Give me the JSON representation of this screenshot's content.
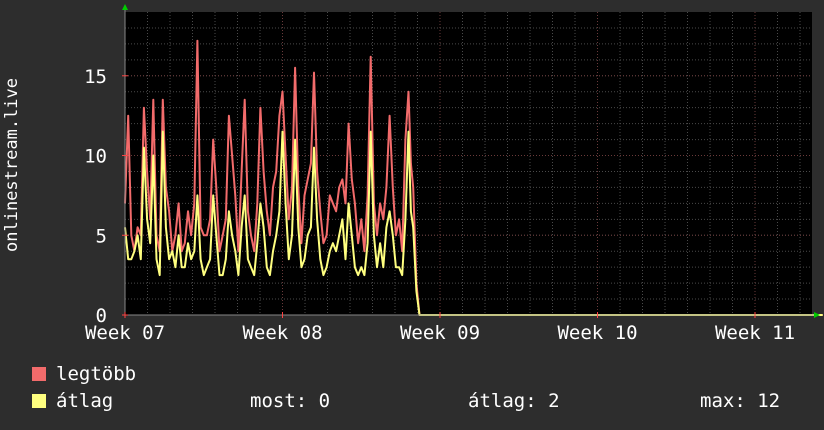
{
  "chart_data": {
    "type": "line",
    "ylabel": "onlinestream.live",
    "x_tick_labels": [
      "Week 07",
      "Week 08",
      "Week 09",
      "Week 10",
      "Week 11"
    ],
    "y_ticks": [
      0,
      5,
      10,
      15
    ],
    "ylim": [
      0,
      19
    ],
    "xlim": [
      0,
      4.435
    ],
    "grid": true,
    "background_color": "#000000",
    "grid_color": "#4a4a4a",
    "tick_color": "#ff4444",
    "axis_color": "#888888",
    "series": [
      {
        "name": "legtöbb",
        "color": "#f26b6b",
        "x": [
          0.0,
          0.02,
          0.04,
          0.06,
          0.08,
          0.1,
          0.12,
          0.14,
          0.16,
          0.18,
          0.2,
          0.22,
          0.24,
          0.26,
          0.28,
          0.3,
          0.32,
          0.34,
          0.36,
          0.38,
          0.4,
          0.42,
          0.44,
          0.46,
          0.48,
          0.5,
          0.52,
          0.54,
          0.56,
          0.58,
          0.6,
          0.62,
          0.64,
          0.66,
          0.68,
          0.7,
          0.72,
          0.74,
          0.76,
          0.78,
          0.8,
          0.82,
          0.84,
          0.86,
          0.88,
          0.9,
          0.92,
          0.94,
          0.96,
          0.98,
          1.0,
          1.02,
          1.04,
          1.06,
          1.08,
          1.1,
          1.12,
          1.14,
          1.16,
          1.18,
          1.2,
          1.22,
          1.24,
          1.26,
          1.28,
          1.3,
          1.32,
          1.34,
          1.36,
          1.38,
          1.4,
          1.42,
          1.44,
          1.46,
          1.48,
          1.5,
          1.52,
          1.54,
          1.56,
          1.58,
          1.6,
          1.62,
          1.64,
          1.66,
          1.68,
          1.7,
          1.72,
          1.74,
          1.76,
          1.78,
          1.8,
          1.815,
          1.83,
          1.85,
          1.87,
          4.43
        ],
        "y": [
          7.0,
          12.5,
          5.0,
          4.0,
          5.5,
          5.0,
          13.0,
          9.0,
          6.0,
          13.5,
          5.0,
          4.0,
          13.5,
          8.0,
          6.5,
          4.0,
          5.0,
          7.0,
          4.0,
          4.5,
          6.5,
          5.0,
          7.0,
          17.2,
          5.5,
          5.0,
          5.0,
          6.0,
          11.0,
          8.0,
          4.0,
          5.0,
          6.0,
          12.5,
          10.0,
          7.5,
          4.0,
          9.0,
          13.5,
          6.5,
          5.0,
          4.0,
          7.0,
          13.0,
          9.0,
          6.5,
          5.0,
          8.0,
          9.0,
          12.5,
          14.0,
          10.0,
          6.0,
          8.0,
          15.5,
          8.0,
          4.5,
          7.5,
          8.5,
          9.5,
          15.2,
          9.0,
          6.5,
          4.5,
          5.0,
          7.5,
          7.0,
          6.5,
          8.0,
          8.5,
          7.0,
          12.0,
          8.5,
          7.0,
          4.5,
          6.0,
          4.0,
          7.5,
          16.2,
          7.0,
          5.0,
          7.0,
          6.0,
          8.0,
          12.5,
          8.0,
          5.0,
          6.0,
          4.0,
          11.0,
          14.0,
          9.5,
          8.0,
          2.0,
          0.0,
          0.0
        ]
      },
      {
        "name": "átlag",
        "color": "#ffff80",
        "x": [
          0.0,
          0.02,
          0.04,
          0.06,
          0.08,
          0.1,
          0.12,
          0.14,
          0.16,
          0.18,
          0.2,
          0.22,
          0.24,
          0.26,
          0.28,
          0.3,
          0.32,
          0.34,
          0.36,
          0.38,
          0.4,
          0.42,
          0.44,
          0.46,
          0.48,
          0.5,
          0.52,
          0.54,
          0.56,
          0.58,
          0.6,
          0.62,
          0.64,
          0.66,
          0.68,
          0.7,
          0.72,
          0.74,
          0.76,
          0.78,
          0.8,
          0.82,
          0.84,
          0.86,
          0.88,
          0.9,
          0.92,
          0.94,
          0.96,
          0.98,
          1.0,
          1.02,
          1.04,
          1.06,
          1.08,
          1.1,
          1.12,
          1.14,
          1.16,
          1.18,
          1.2,
          1.22,
          1.24,
          1.26,
          1.28,
          1.3,
          1.32,
          1.34,
          1.36,
          1.38,
          1.4,
          1.42,
          1.44,
          1.46,
          1.48,
          1.5,
          1.52,
          1.54,
          1.56,
          1.58,
          1.6,
          1.62,
          1.64,
          1.66,
          1.68,
          1.7,
          1.72,
          1.74,
          1.76,
          1.78,
          1.8,
          1.815,
          1.83,
          1.85,
          1.87,
          4.43
        ],
        "y": [
          5.5,
          3.5,
          3.5,
          4.0,
          5.0,
          3.5,
          10.5,
          6.0,
          4.5,
          10.0,
          3.5,
          2.5,
          11.5,
          5.5,
          3.5,
          4.0,
          3.0,
          5.0,
          3.0,
          3.0,
          4.5,
          3.5,
          4.0,
          7.5,
          3.5,
          2.5,
          3.0,
          3.5,
          7.5,
          5.0,
          2.5,
          2.5,
          3.5,
          6.5,
          5.0,
          4.0,
          2.5,
          5.5,
          7.5,
          3.5,
          3.0,
          2.5,
          4.5,
          7.0,
          5.5,
          3.0,
          2.5,
          4.0,
          5.0,
          6.5,
          11.5,
          7.0,
          3.5,
          5.0,
          11.0,
          5.5,
          3.0,
          3.5,
          5.0,
          5.5,
          10.5,
          6.0,
          3.5,
          2.5,
          3.0,
          4.0,
          4.5,
          4.0,
          5.0,
          6.0,
          3.5,
          7.0,
          5.0,
          3.0,
          2.5,
          3.0,
          2.5,
          4.5,
          11.5,
          5.0,
          3.0,
          4.5,
          3.0,
          5.5,
          6.5,
          5.0,
          3.0,
          3.0,
          2.5,
          6.0,
          11.5,
          6.5,
          5.5,
          1.5,
          0.0,
          0.0
        ]
      }
    ]
  },
  "legend": [
    {
      "label": "legtöbb",
      "color": "#f26b6b"
    },
    {
      "label": "átlag",
      "color": "#ffff80"
    }
  ],
  "stats": {
    "now": "most: 0",
    "avg": "átlag: 2",
    "max": "max: 12"
  }
}
